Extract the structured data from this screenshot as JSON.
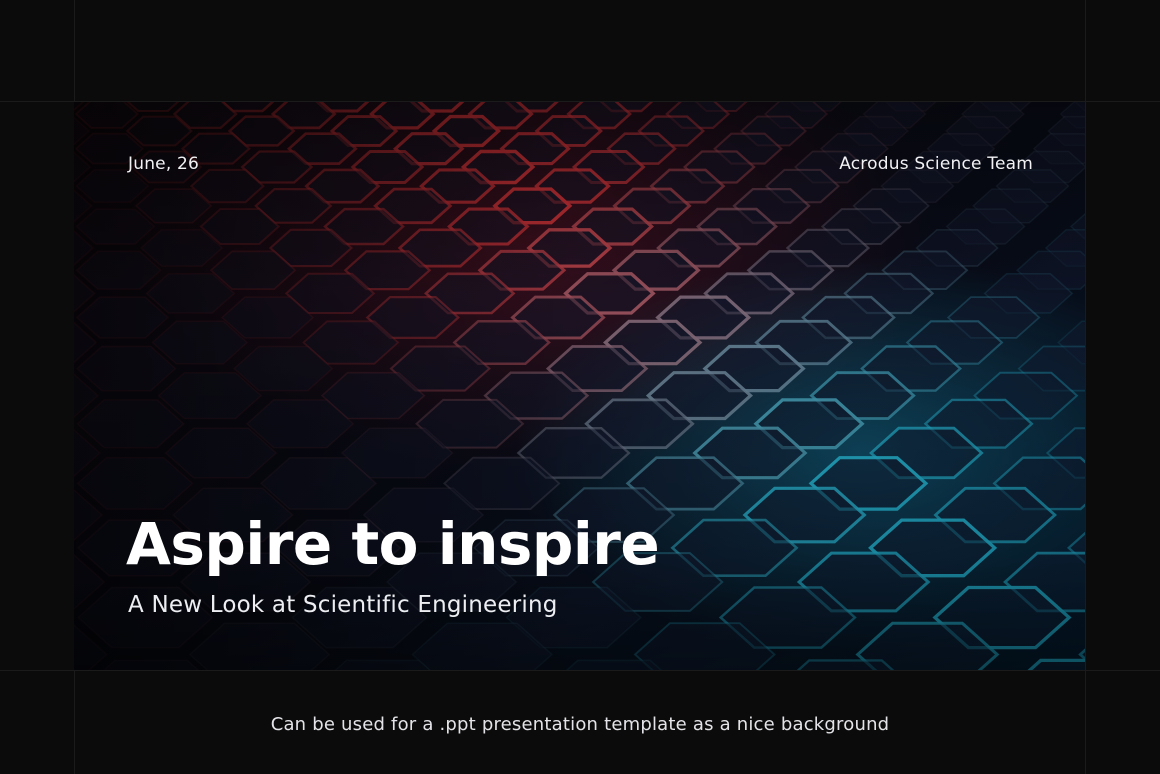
{
  "slide": {
    "date": "June, 26",
    "team": "Acrodus Science Team",
    "title": "Aspire to inspire",
    "subtitle": "A New Look at Scientific Engineering"
  },
  "caption": "Can be used for a .ppt presentation template as a nice background",
  "colors": {
    "page_background": "#0b0b0b",
    "glow_red": "#ff3b3b",
    "glow_cyan": "#2fe6ff",
    "text": "#ffffff"
  }
}
